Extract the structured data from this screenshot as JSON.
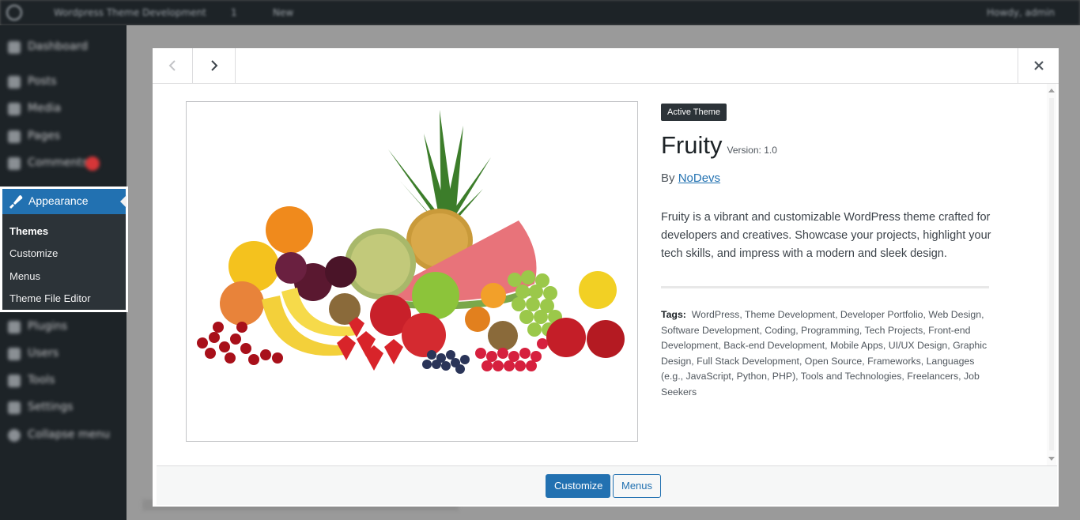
{
  "admin_bar": {
    "site_name": "Wordpress Theme Development",
    "updates_count": "1",
    "new_label": "New",
    "user_greeting": "Howdy, admin"
  },
  "admin_menu": {
    "items": [
      {
        "label": "Dashboard",
        "icon": "dashboard-icon"
      },
      {
        "label": "Posts",
        "icon": "pin-icon"
      },
      {
        "label": "Media",
        "icon": "media-icon"
      },
      {
        "label": "Pages",
        "icon": "page-icon"
      },
      {
        "label": "Comments",
        "icon": "comment-icon"
      },
      {
        "label": "Plugins",
        "icon": "plugin-icon"
      },
      {
        "label": "Users",
        "icon": "users-icon"
      },
      {
        "label": "Tools",
        "icon": "tools-icon"
      },
      {
        "label": "Settings",
        "icon": "settings-icon"
      },
      {
        "label": "Collapse menu",
        "icon": "collapse-icon"
      }
    ],
    "appearance": {
      "label": "Appearance",
      "icon": "paintbrush-icon",
      "submenu": [
        {
          "label": "Themes",
          "current": true
        },
        {
          "label": "Customize",
          "current": false
        },
        {
          "label": "Menus",
          "current": false
        },
        {
          "label": "Theme File Editor",
          "current": false
        }
      ]
    }
  },
  "modal": {
    "badge": "Active Theme",
    "theme_name": "Fruity",
    "version": "Version: 1.0",
    "author_prefix": "By",
    "author_name": "NoDevs",
    "description": "Fruity is a vibrant and customizable WordPress theme crafted for developers and creatives. Showcase your projects, highlight your tech skills, and impress with a modern and sleek design.",
    "tags_label": "Tags:",
    "tags": "WordPress, Theme Development, Developer Portfolio, Web Design, Software Development, Coding, Programming, Tech Projects, Front-end Development, Back-end Development, Mobile Apps, UI/UX Design, Graphic Design, Full Stack Development, Open Source, Frameworks, Languages (e.g., JavaScript, Python, PHP), Tools and Technologies, Freelancers, Job Seekers",
    "footer": {
      "customize_label": "Customize",
      "menus_label": "Menus"
    }
  },
  "colors": {
    "accent": "#2271b1",
    "admin_dark": "#1d2327",
    "badge_bg": "#2c3338"
  }
}
